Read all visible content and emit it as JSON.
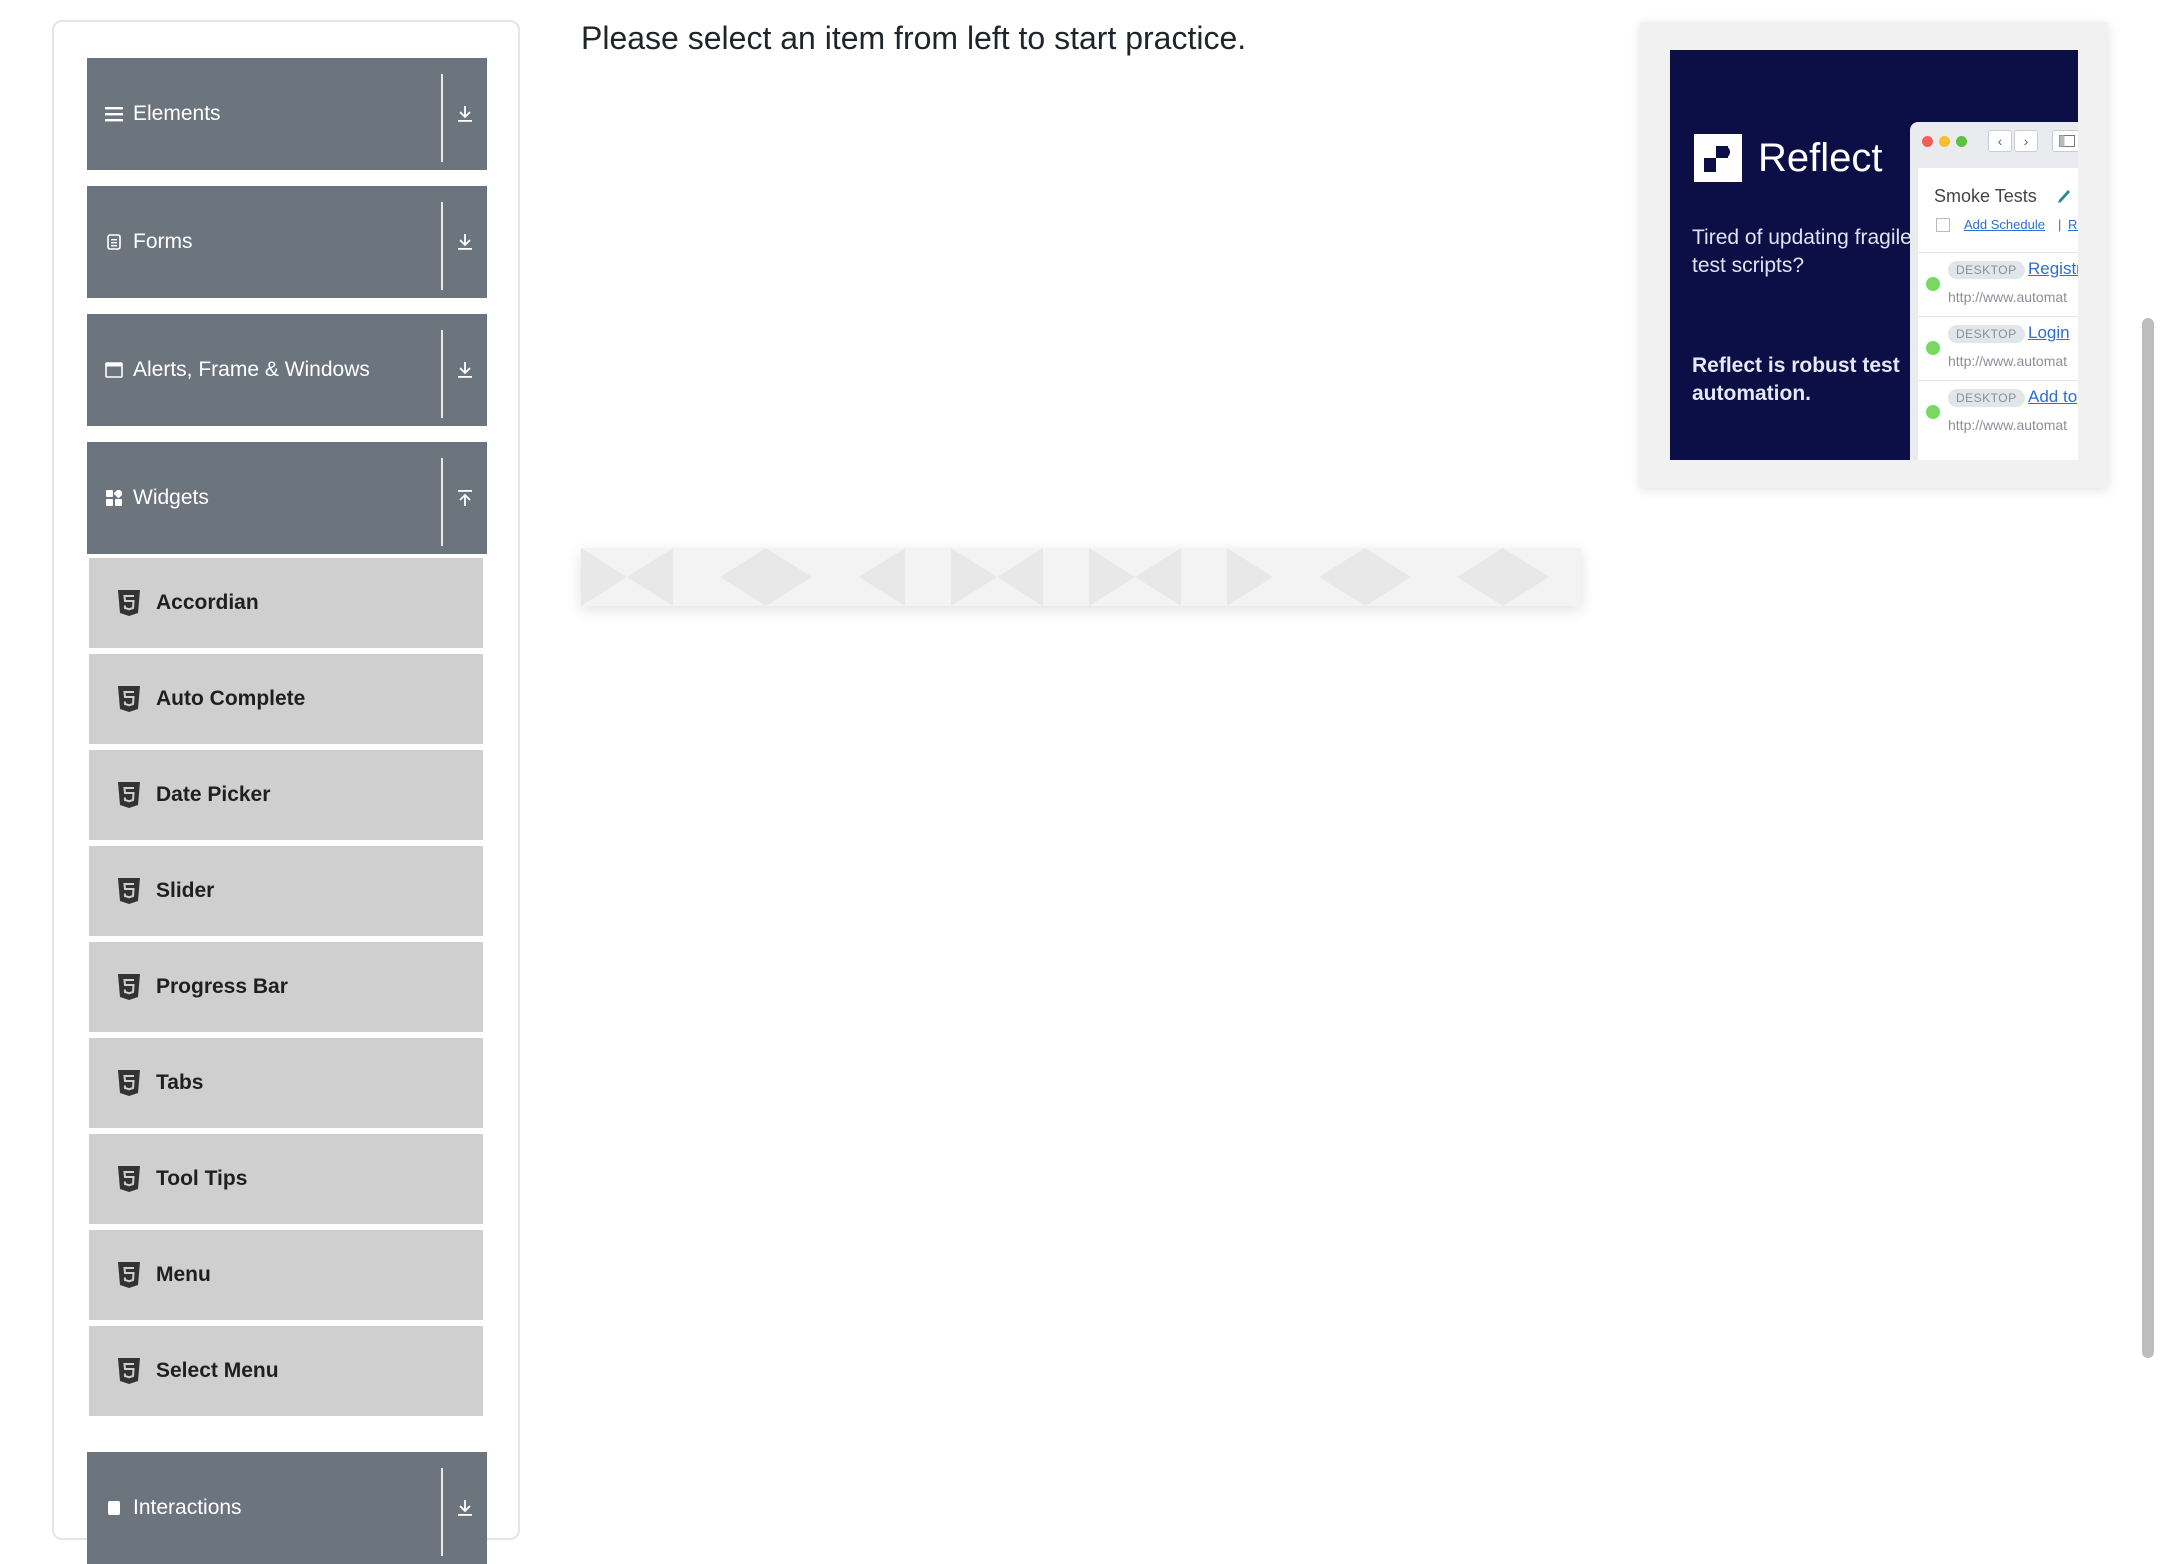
{
  "sidebar": {
    "groups": [
      {
        "label": "Elements",
        "icon": "list-icon",
        "toggle": "expand-down-icon"
      },
      {
        "label": "Forms",
        "icon": "form-icon",
        "toggle": "expand-down-icon"
      },
      {
        "label": "Alerts, Frame & Windows",
        "icon": "window-icon",
        "toggle": "expand-down-icon"
      },
      {
        "label": "Widgets",
        "icon": "widgets-icon",
        "toggle": "collapse-up-icon"
      },
      {
        "label": "Interactions",
        "icon": "interactions-icon",
        "toggle": "expand-down-icon"
      }
    ],
    "widget_items": [
      {
        "label": "Accordian",
        "icon": "html5-icon"
      },
      {
        "label": "Auto Complete",
        "icon": "html5-icon"
      },
      {
        "label": "Date Picker",
        "icon": "html5-icon"
      },
      {
        "label": "Slider",
        "icon": "html5-icon"
      },
      {
        "label": "Progress Bar",
        "icon": "html5-icon"
      },
      {
        "label": "Tabs",
        "icon": "html5-icon"
      },
      {
        "label": "Tool Tips",
        "icon": "html5-icon"
      },
      {
        "label": "Menu",
        "icon": "html5-icon"
      },
      {
        "label": "Select Menu",
        "icon": "html5-icon"
      }
    ]
  },
  "main": {
    "message": "Please select an item from left to start practice."
  },
  "ad": {
    "brand": "Reflect",
    "tagline": "Tired of updating fragile test scripts?",
    "cta": "Reflect is robust test automation.",
    "mock": {
      "title": "Smoke Tests",
      "schedule_link": "Add Schedule",
      "separator": "|",
      "run_link": "Ru",
      "rows": [
        {
          "badge": "DESKTOP",
          "name": "Registr",
          "url": "http://www.automat"
        },
        {
          "badge": "DESKTOP",
          "name": "Login",
          "url": "http://www.automat"
        },
        {
          "badge": "DESKTOP",
          "name": "Add to",
          "url": "http://www.automat"
        }
      ]
    }
  },
  "colors": {
    "group_header_bg": "#6c747e",
    "menu_item_bg": "#cfcfcf",
    "ad_bg": "#0b0f45",
    "status_green": "#78d860",
    "link_blue": "#2a6fd6"
  }
}
